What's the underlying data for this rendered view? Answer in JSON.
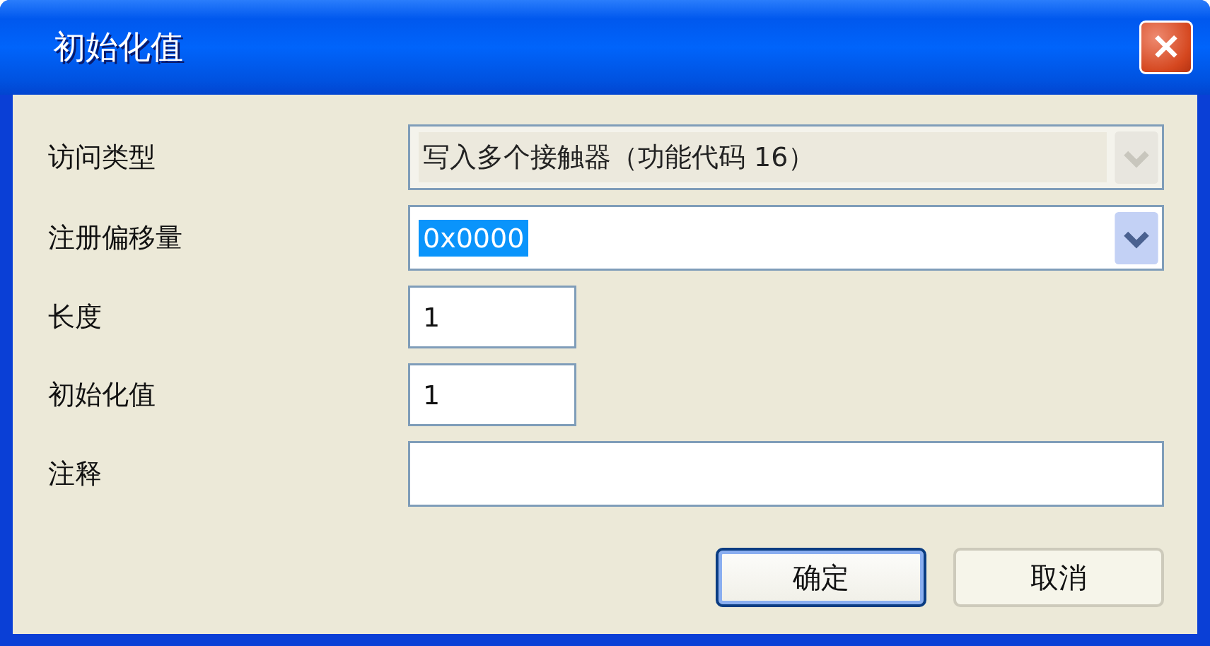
{
  "window": {
    "title": "初始化值",
    "close_label": "✕"
  },
  "fields": [
    {
      "label": "访问类型",
      "kind": "combo",
      "disabled": true,
      "value": "写入多个接触器（功能代码 16）"
    },
    {
      "label": "注册偏移量",
      "kind": "combo",
      "disabled": false,
      "value": "0x0000",
      "value_selected": true
    },
    {
      "label": "长度",
      "kind": "number",
      "disabled": false,
      "value": "1"
    },
    {
      "label": "初始化值",
      "kind": "number",
      "disabled": false,
      "value": "1"
    },
    {
      "label": "注释",
      "kind": "text",
      "disabled": false
    }
  ],
  "buttons": [
    {
      "label": "确定",
      "default": true
    },
    {
      "label": "取消",
      "default": false
    }
  ]
}
